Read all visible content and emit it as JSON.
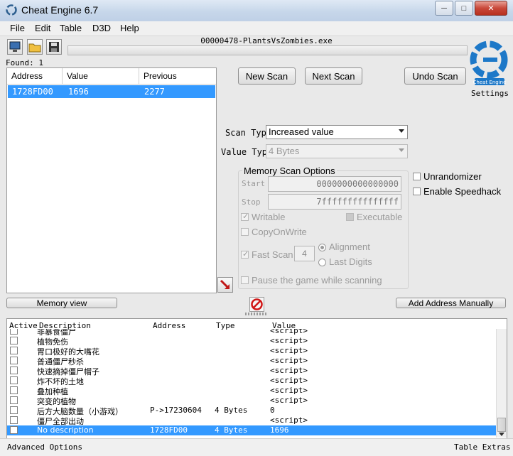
{
  "window": {
    "title": "Cheat Engine 6.7"
  },
  "menu": [
    "File",
    "Edit",
    "Table",
    "D3D",
    "Help"
  ],
  "process_name": "00000478-PlantsVsZombies.exe",
  "found_label": "Found: 1",
  "found_list": {
    "columns": [
      "Address",
      "Value",
      "Previous"
    ],
    "rows": [
      {
        "address": "1728FD00",
        "value": "1696",
        "previous": "2277"
      }
    ]
  },
  "buttons": {
    "new_scan": "New Scan",
    "next_scan": "Next Scan",
    "undo_scan": "Undo Scan",
    "memory_view": "Memory view",
    "add_address": "Add Address Manually"
  },
  "logo": {
    "settings_label": "Settings",
    "brand_text": "Cheat Engine"
  },
  "scan": {
    "scan_type_label": "Scan Type",
    "scan_type_value": "Increased value",
    "value_type_label": "Value Type",
    "value_type_value": "4 Bytes"
  },
  "memory_options": {
    "title": "Memory Scan Options",
    "start_label": "Start",
    "start_value": "0000000000000000",
    "stop_label": "Stop",
    "stop_value": "7fffffffffffffff",
    "writable": "Writable",
    "executable": "Executable",
    "copy_on_write": "CopyOnWrite",
    "fast_scan": "Fast Scan",
    "fast_scan_value": "4",
    "alignment": "Alignment",
    "last_digits": "Last Digits",
    "pause_game": "Pause the game while scanning"
  },
  "side_options": {
    "unrandomizer": "Unrandomizer",
    "speedhack": "Enable Speedhack"
  },
  "address_table": {
    "columns": [
      "Active",
      "Description",
      "Address",
      "Type",
      "Value"
    ],
    "rows": [
      {
        "description": "非暴食僵尸",
        "address": "",
        "type": "",
        "value": "<script>"
      },
      {
        "description": "植物免伤",
        "address": "",
        "type": "",
        "value": "<script>"
      },
      {
        "description": "胃口极好的大嘴花",
        "address": "",
        "type": "",
        "value": "<script>"
      },
      {
        "description": "普通僵尸秒杀",
        "address": "",
        "type": "",
        "value": "<script>"
      },
      {
        "description": "快速摘掉僵尸帽子",
        "address": "",
        "type": "",
        "value": "<script>"
      },
      {
        "description": "炸不坏的土地",
        "address": "",
        "type": "",
        "value": "<script>"
      },
      {
        "description": "叠加种植",
        "address": "",
        "type": "",
        "value": "<script>"
      },
      {
        "description": "突变的植物",
        "address": "",
        "type": "",
        "value": "<script>"
      },
      {
        "description": "后方大脑数量（小游戏）",
        "address": "P->17230604",
        "type": "4 Bytes",
        "value": "0"
      },
      {
        "description": "僵尸全部出动",
        "address": "",
        "type": "",
        "value": "<script>"
      },
      {
        "description": "No description",
        "address": "1728FD00",
        "type": "4 Bytes",
        "value": "1696"
      }
    ]
  },
  "status": {
    "left": "Advanced Options",
    "right": "Table Extras"
  }
}
